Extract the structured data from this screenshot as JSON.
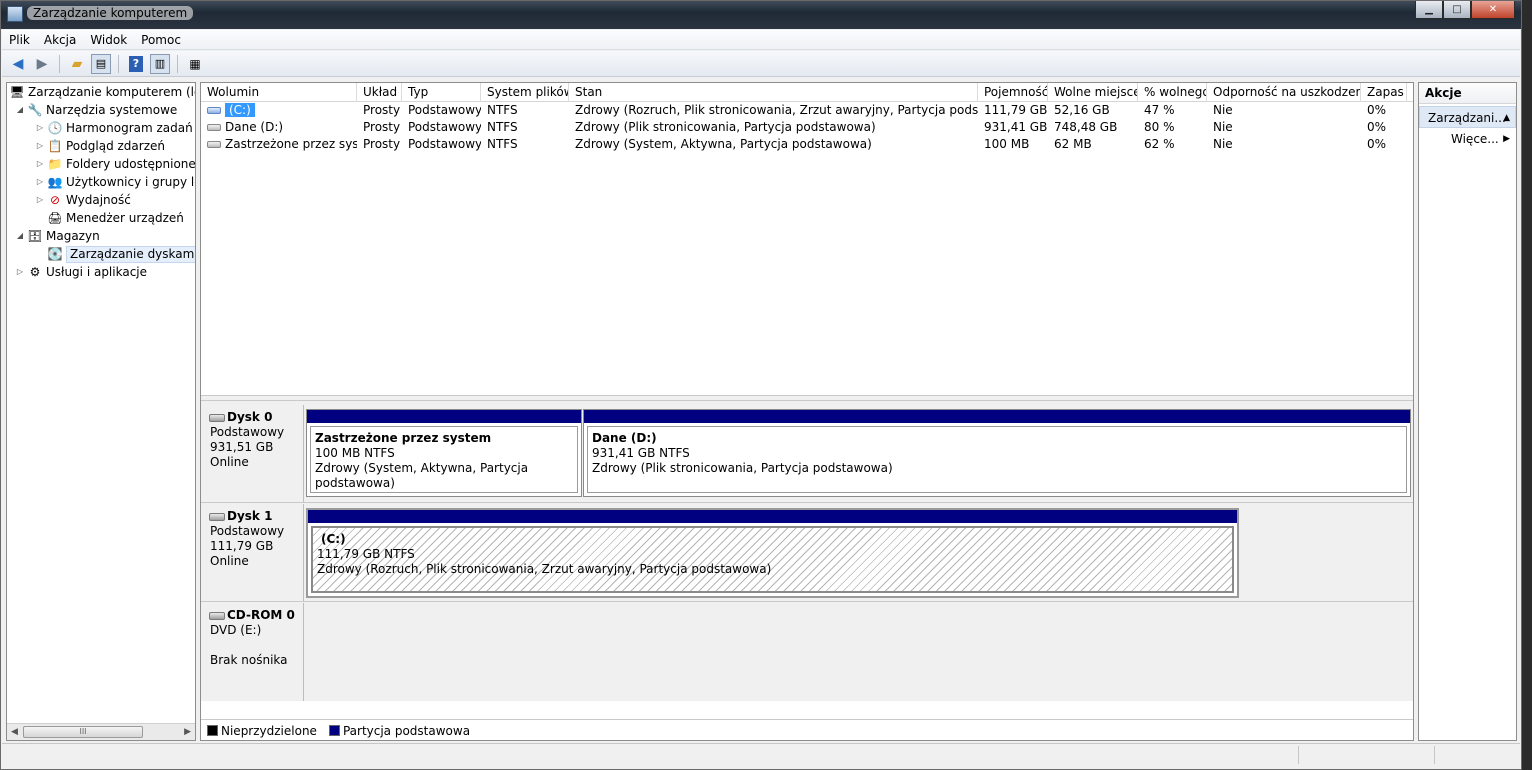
{
  "window": {
    "title": "Zarządzanie komputerem"
  },
  "menu": [
    "Plik",
    "Akcja",
    "Widok",
    "Pomoc"
  ],
  "toolbar": {
    "buttons": [
      "back-icon",
      "forward-icon",
      "up-folder-icon",
      "show-hide-tree-icon",
      "help-icon",
      "show-hide-action-icon",
      "properties-icon"
    ]
  },
  "tree": {
    "root": "Zarządzanie komputerem (loka",
    "system_tools": "Narzędzia systemowe",
    "task_scheduler": "Harmonogram zadań",
    "event_viewer": "Podgląd zdarzeń",
    "shared_folders": "Foldery udostępnione",
    "local_users": "Użytkownicy i grupy lok",
    "performance": "Wydajność",
    "device_manager": "Menedżer urządzeń",
    "storage": "Magazyn",
    "disk_management": "Zarządzanie dyskami",
    "services": "Usługi i aplikacje",
    "scroll_thumb": "III"
  },
  "volumes": {
    "columns": [
      "Wolumin",
      "Układ",
      "Typ",
      "System plików",
      "Stan",
      "Pojemność",
      "Wolne miejsce",
      "% wolnego",
      "Odporność na uszkodzenia",
      "Zapas"
    ],
    "rows": [
      {
        "name": "(C:)",
        "layout": "Prosty",
        "type": "Podstawowy",
        "fs": "NTFS",
        "status": "Zdrowy (Rozruch, Plik stronicowania, Zrzut awaryjny, Partycja podstawowa)",
        "capacity": "111,79 GB",
        "free": "52,16 GB",
        "pct": "47 %",
        "fault": "Nie",
        "overhead": "0%"
      },
      {
        "name": "Dane (D:)",
        "layout": "Prosty",
        "type": "Podstawowy",
        "fs": "NTFS",
        "status": "Zdrowy (Plik stronicowania, Partycja podstawowa)",
        "capacity": "931,41 GB",
        "free": "748,48 GB",
        "pct": "80 %",
        "fault": "Nie",
        "overhead": "0%"
      },
      {
        "name": "Zastrzeżone przez system",
        "layout": "Prosty",
        "type": "Podstawowy",
        "fs": "NTFS",
        "status": "Zdrowy (System, Aktywna, Partycja podstawowa)",
        "capacity": "100 MB",
        "free": "62 MB",
        "pct": "62 %",
        "fault": "Nie",
        "overhead": "0%"
      }
    ]
  },
  "disks": [
    {
      "name": "Dysk 0",
      "type": "Podstawowy",
      "size": "931,51 GB",
      "status": "Online",
      "partitions": [
        {
          "title": "Zastrzeżone przez system",
          "size": "100 MB NTFS",
          "status": "Zdrowy (System, Aktywna, Partycja podstawowa)"
        },
        {
          "title": "Dane  (D:)",
          "size": "931,41 GB NTFS",
          "status": "Zdrowy (Plik stronicowania, Partycja podstawowa)"
        }
      ]
    },
    {
      "name": "Dysk 1",
      "type": "Podstawowy",
      "size": "111,79 GB",
      "status": "Online",
      "partitions": [
        {
          "title": "(C:)",
          "size": "111,79 GB NTFS",
          "status": "Zdrowy (Rozruch, Plik stronicowania, Zrzut awaryjny, Partycja podstawowa)"
        }
      ]
    },
    {
      "name": "CD-ROM 0",
      "type": "DVD (E:)",
      "status": "Brak nośnika"
    }
  ],
  "legend": {
    "unallocated": "Nieprzydzielone",
    "primary": "Partycja podstawowa",
    "unallocated_color": "#000000",
    "primary_color": "#000080"
  },
  "actions": {
    "header": "Akcje",
    "group": "Zarządzani...",
    "more": "Więce..."
  }
}
